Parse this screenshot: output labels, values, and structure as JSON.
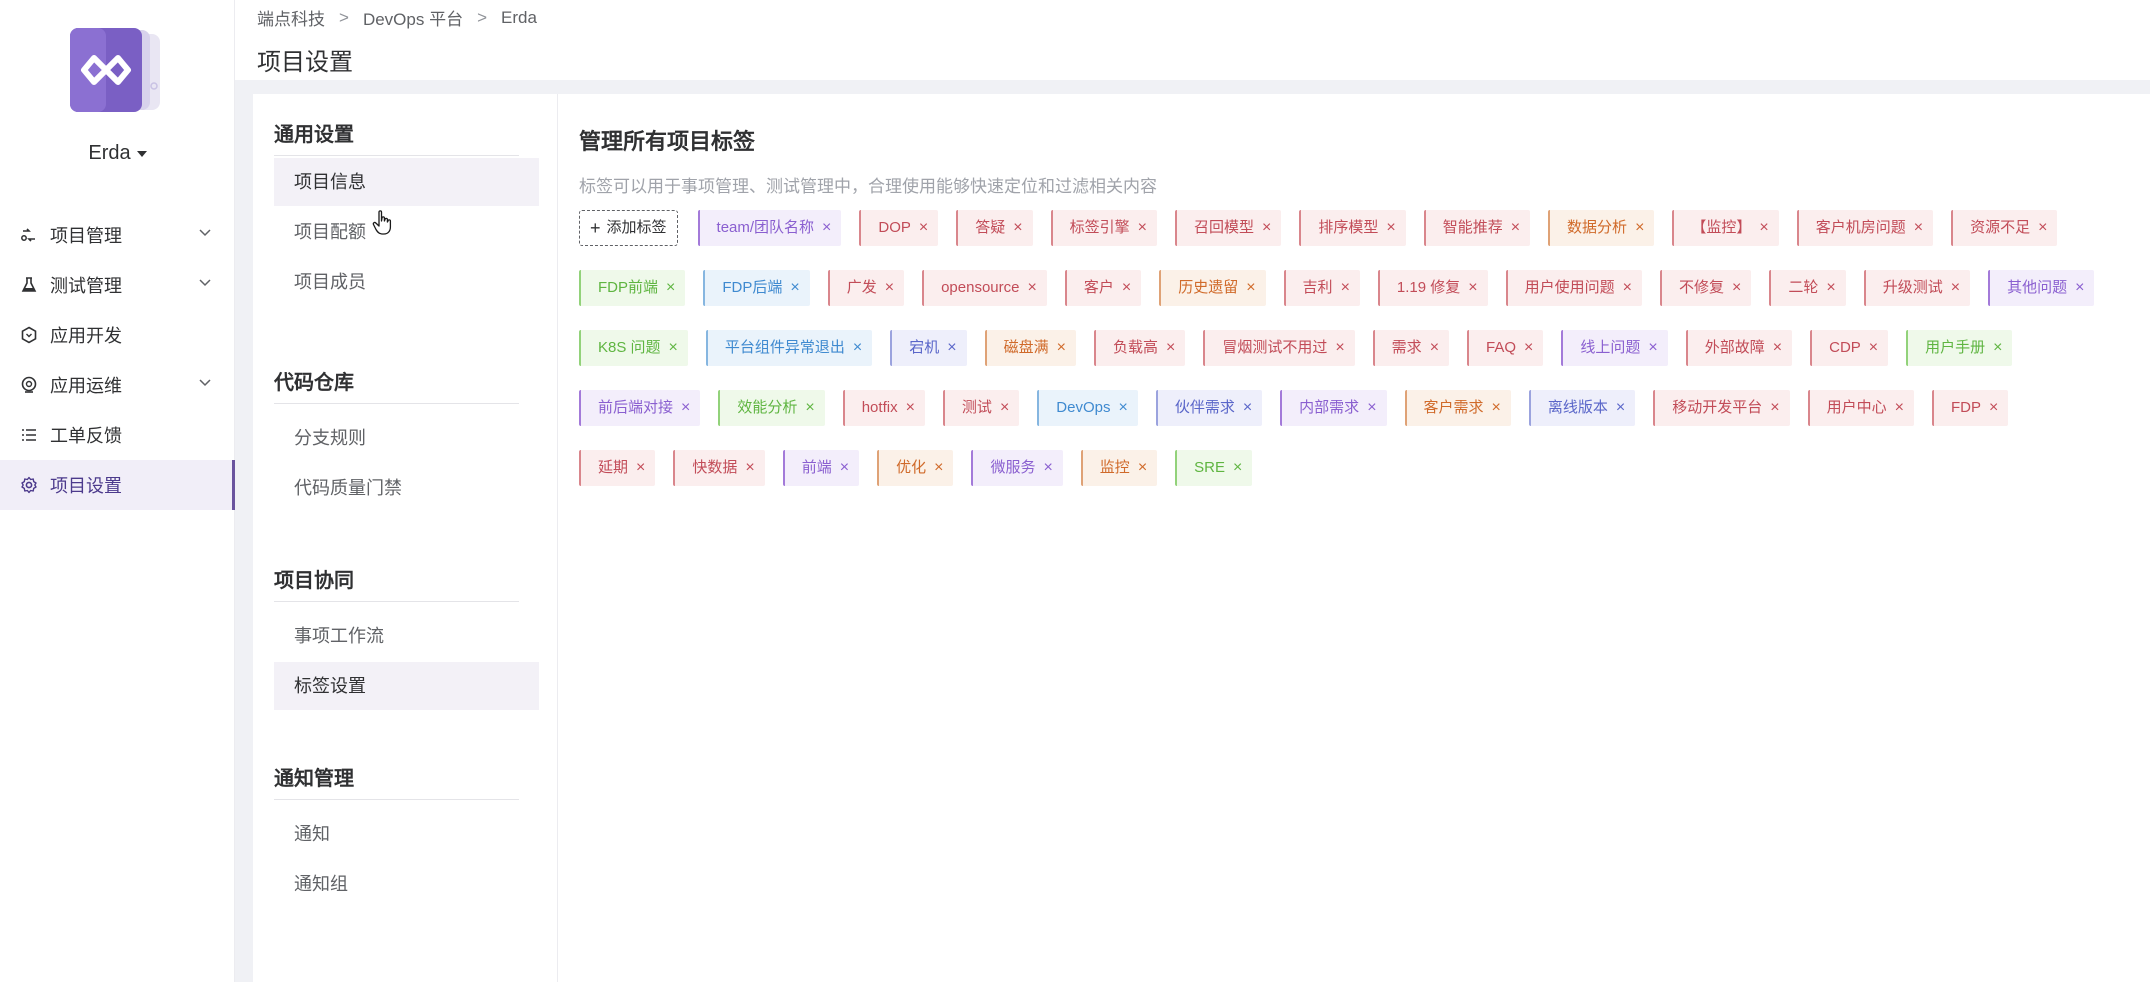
{
  "app": {
    "project_name": "Erda",
    "logo_icon": "erda-logo-icon"
  },
  "nav": {
    "items": [
      {
        "label": "项目管理",
        "icon": "project-icon",
        "expandable": true
      },
      {
        "label": "测试管理",
        "icon": "flask-icon",
        "expandable": true
      },
      {
        "label": "应用开发",
        "icon": "hexagon-icon",
        "expandable": false
      },
      {
        "label": "应用运维",
        "icon": "ops-icon",
        "expandable": true
      },
      {
        "label": "工单反馈",
        "icon": "list-icon",
        "expandable": false
      },
      {
        "label": "项目设置",
        "icon": "gear-icon",
        "expandable": false,
        "active": true
      }
    ]
  },
  "breadcrumb": [
    "端点科技",
    "DevOps 平台",
    "Erda"
  ],
  "page_title": "项目设置",
  "settings_menu": {
    "groups": [
      {
        "title": "通用设置",
        "items": [
          "项目信息",
          "项目配额",
          "项目成员"
        ]
      },
      {
        "title": "代码仓库",
        "items": [
          "分支规则",
          "代码质量门禁"
        ]
      },
      {
        "title": "项目协同",
        "items": [
          "事项工作流",
          "标签设置"
        ],
        "active": "标签设置"
      },
      {
        "title": "通知管理",
        "items": [
          "通知",
          "通知组"
        ]
      }
    ]
  },
  "main": {
    "title": "管理所有项目标签",
    "description": "标签可以用于事项管理、测试管理中，合理使用能够快速定位和过滤相关内容",
    "add_tag_label": "添加标签",
    "tags": [
      {
        "label": "team/团队名称",
        "color": "purple"
      },
      {
        "label": "DOP",
        "color": "red"
      },
      {
        "label": "答疑",
        "color": "red"
      },
      {
        "label": "标签引擎",
        "color": "red"
      },
      {
        "label": "召回模型",
        "color": "red"
      },
      {
        "label": "排序模型",
        "color": "red"
      },
      {
        "label": "智能推荐",
        "color": "red"
      },
      {
        "label": "数据分析",
        "color": "orange"
      },
      {
        "label": "【监控】",
        "color": "red"
      },
      {
        "label": "客户机房问题",
        "color": "red"
      },
      {
        "label": "资源不足",
        "color": "red"
      },
      {
        "label": "FDP前端",
        "color": "green"
      },
      {
        "label": "FDP后端",
        "color": "blue"
      },
      {
        "label": "广发",
        "color": "red"
      },
      {
        "label": "opensource",
        "color": "red"
      },
      {
        "label": "客户",
        "color": "red"
      },
      {
        "label": "历史遗留",
        "color": "orange"
      },
      {
        "label": "吉利",
        "color": "red"
      },
      {
        "label": "1.19 修复",
        "color": "red"
      },
      {
        "label": "用户使用问题",
        "color": "red"
      },
      {
        "label": "不修复",
        "color": "red"
      },
      {
        "label": "二轮",
        "color": "red"
      },
      {
        "label": "升级测试",
        "color": "red"
      },
      {
        "label": "其他问题",
        "color": "purple"
      },
      {
        "label": "K8S 问题",
        "color": "green"
      },
      {
        "label": "平台组件异常退出",
        "color": "blue"
      },
      {
        "label": "宕机",
        "color": "indigo"
      },
      {
        "label": "磁盘满",
        "color": "orange"
      },
      {
        "label": "负载高",
        "color": "red"
      },
      {
        "label": "冒烟测试不用过",
        "color": "red"
      },
      {
        "label": "需求",
        "color": "red"
      },
      {
        "label": "FAQ",
        "color": "red"
      },
      {
        "label": "线上问题",
        "color": "purple"
      },
      {
        "label": "外部故障",
        "color": "red"
      },
      {
        "label": "CDP",
        "color": "red"
      },
      {
        "label": "用户手册",
        "color": "green"
      },
      {
        "label": "前后端对接",
        "color": "purple"
      },
      {
        "label": "效能分析",
        "color": "green"
      },
      {
        "label": "hotfix",
        "color": "red"
      },
      {
        "label": "测试",
        "color": "red"
      },
      {
        "label": "DevOps",
        "color": "blue"
      },
      {
        "label": "伙伴需求",
        "color": "indigo"
      },
      {
        "label": "内部需求",
        "color": "purple"
      },
      {
        "label": "客户需求",
        "color": "orange"
      },
      {
        "label": "离线版本",
        "color": "indigo"
      },
      {
        "label": "移动开发平台",
        "color": "red"
      },
      {
        "label": "用户中心",
        "color": "red"
      },
      {
        "label": "FDP",
        "color": "red"
      },
      {
        "label": "延期",
        "color": "red"
      },
      {
        "label": "快数据",
        "color": "red"
      },
      {
        "label": "前端",
        "color": "purple"
      },
      {
        "label": "优化",
        "color": "orange"
      },
      {
        "label": "微服务",
        "color": "purple"
      },
      {
        "label": "监控",
        "color": "orange"
      },
      {
        "label": "SRE",
        "color": "green"
      }
    ]
  },
  "colors": {
    "accent": "#6a549e",
    "active_bg": "#f1eef8"
  }
}
